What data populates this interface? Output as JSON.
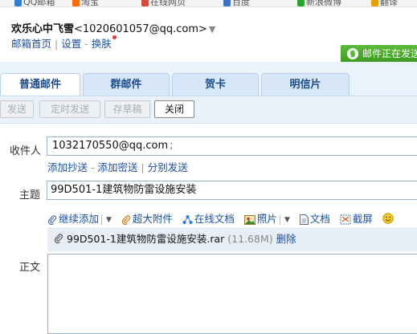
{
  "bookmarks": [
    {
      "label": "QQ邮箱",
      "color": "#2f7fd8"
    },
    {
      "label": "淘宝",
      "color": "#ff6a00"
    },
    {
      "label": "在线网页",
      "color": "#d44b3a"
    },
    {
      "label": "百度",
      "color": "#3b71c9"
    },
    {
      "label": "新浪微博",
      "color": "#2aa52a"
    },
    {
      "label": "翻译",
      "color": "#e8a000"
    }
  ],
  "account": {
    "name": "欢乐心中飞雪",
    "email": "<1020601057@qq.com>",
    "caret": "▼"
  },
  "top_links": {
    "home": "邮箱首页",
    "settings": "设置",
    "skin": "换肤"
  },
  "status": {
    "sending": "邮件正在发送"
  },
  "tabs": [
    {
      "label": "普通邮件",
      "active": true
    },
    {
      "label": "群邮件",
      "active": false
    },
    {
      "label": "贺卡",
      "active": false
    },
    {
      "label": "明信片",
      "active": false
    }
  ],
  "toolbar": {
    "send": "发送",
    "scheduled_send": "定时发送",
    "save_draft": "存草稿",
    "close": "关闭"
  },
  "form": {
    "to_label": "收件人",
    "to_value": "1032170550@qq.com",
    "to_separator": ";",
    "add_cc": "添加抄送",
    "add_bcc": "添加密送",
    "separate_send": "分别发送",
    "subject_label": "主题",
    "subject_value": "99D501-1建筑物防雷设施安装",
    "body_label": "正文"
  },
  "attach_tools": {
    "continue_add": "继续添加",
    "large_attachment": "超大附件",
    "online_doc": "在线文档",
    "photo": "照片",
    "document": "文档",
    "screenshot": "截屏"
  },
  "attachment": {
    "filename": "99D501-1建筑物防雷设施安装.rar",
    "size": "(11.68M)",
    "delete": "删除"
  }
}
